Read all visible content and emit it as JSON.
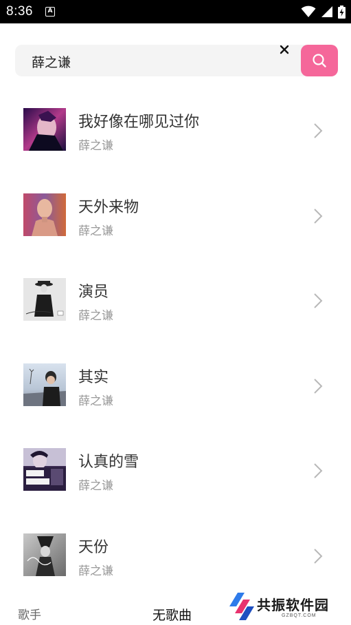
{
  "status_bar": {
    "time": "8:36",
    "notification_icon": "A",
    "icons": [
      "wifi-icon",
      "signal-icon",
      "battery-charging-icon"
    ]
  },
  "search": {
    "value": "薛之谦",
    "clear_icon": "close-icon",
    "button_icon": "search-icon",
    "button_color": "#f5679a"
  },
  "songs": [
    {
      "title": "我好像在哪见过你",
      "artist": "薛之谦"
    },
    {
      "title": "天外来物",
      "artist": "薛之谦"
    },
    {
      "title": "演员",
      "artist": "薛之谦"
    },
    {
      "title": "其实",
      "artist": "薛之谦"
    },
    {
      "title": "认真的雪",
      "artist": "薛之谦"
    },
    {
      "title": "天份",
      "artist": "薛之谦"
    }
  ],
  "bottom": {
    "tab_singer": "歌手",
    "no_songs": "无歌曲"
  },
  "watermark": {
    "text": "共振软件园",
    "sub": "GZBQT.COM"
  }
}
